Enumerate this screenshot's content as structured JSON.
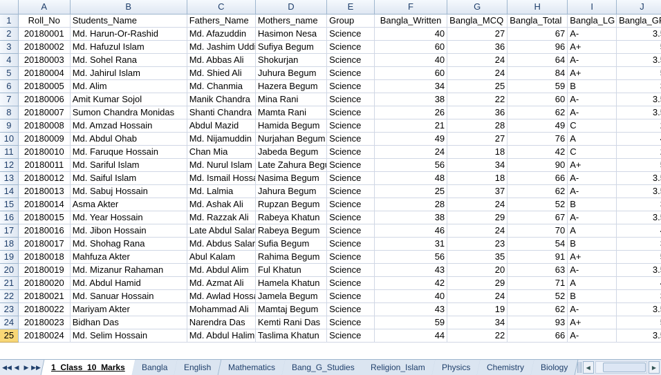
{
  "columns": [
    "A",
    "B",
    "C",
    "D",
    "E",
    "F",
    "G",
    "H",
    "I",
    "J"
  ],
  "headers": [
    "Roll_No",
    "Students_Name",
    "Fathers_Name",
    "Mothers_name",
    "Group",
    "Bangla_Written",
    "Bangla_MCQ",
    "Bangla_Total",
    "Bangla_LG",
    "Bangla_GP"
  ],
  "active_row": "25",
  "rows": [
    [
      "2",
      "20180001",
      "Md. Harun-Or-Rashid",
      "Md. Afazuddin",
      "Hasimon Nesa",
      "Science",
      "40",
      "27",
      "67",
      "A-",
      "3.5"
    ],
    [
      "3",
      "20180002",
      "Md. Hafuzul Islam",
      "Md. Jashim Uddin",
      "Sufiya Begum",
      "Science",
      "60",
      "36",
      "96",
      "A+",
      "5"
    ],
    [
      "4",
      "20180003",
      "Md. Sohel Rana",
      "Md. Abbas Ali",
      "Shokurjan",
      "Science",
      "40",
      "24",
      "64",
      "A-",
      "3.5"
    ],
    [
      "5",
      "20180004",
      "Md. Jahirul Islam",
      "Md. Shied Ali",
      "Juhura Begum",
      "Science",
      "60",
      "24",
      "84",
      "A+",
      "5"
    ],
    [
      "6",
      "20180005",
      "Md. Alim",
      "Md. Chanmia",
      "Hazera Begum",
      "Science",
      "34",
      "25",
      "59",
      "B",
      "3"
    ],
    [
      "7",
      "20180006",
      "Amit Kumar Sojol",
      "Manik Chandra",
      "Mina Rani",
      "Science",
      "38",
      "22",
      "60",
      "A-",
      "3.5"
    ],
    [
      "8",
      "20180007",
      "Sumon Chandra Monidas",
      "Shanti Chandra",
      "Mamta Rani",
      "Science",
      "26",
      "36",
      "62",
      "A-",
      "3.5"
    ],
    [
      "9",
      "20180008",
      "Md. Amzad Hossain",
      "Abdul Mazid",
      "Hamida Begum",
      "Science",
      "21",
      "28",
      "49",
      "C",
      "2"
    ],
    [
      "10",
      "20180009",
      "Md. Abdul Ohab",
      "Md. Nijamuddin",
      "Nurjahan Begum",
      "Science",
      "49",
      "27",
      "76",
      "A",
      "4"
    ],
    [
      "11",
      "20180010",
      "Md. Faruque Hossain",
      "Chan Mia",
      "Jabeda Begum",
      "Science",
      "24",
      "18",
      "42",
      "C",
      "2"
    ],
    [
      "12",
      "20180011",
      "Md. Sariful Islam",
      "Md. Nurul Islam",
      "Late Zahura Begum",
      "Science",
      "56",
      "34",
      "90",
      "A+",
      "5"
    ],
    [
      "13",
      "20180012",
      "Md. Saiful Islam",
      "Md. Ismail Hossain",
      "Nasima Begum",
      "Science",
      "48",
      "18",
      "66",
      "A-",
      "3.5"
    ],
    [
      "14",
      "20180013",
      "Md. Sabuj Hossain",
      "Md. Lalmia",
      "Jahura Begum",
      "Science",
      "25",
      "37",
      "62",
      "A-",
      "3.5"
    ],
    [
      "15",
      "20180014",
      "Asma Akter",
      "Md. Ashak Ali",
      "Rupzan Begum",
      "Science",
      "28",
      "24",
      "52",
      "B",
      "3"
    ],
    [
      "16",
      "20180015",
      "Md. Year Hossain",
      "Md. Razzak Ali",
      "Rabeya Khatun",
      "Science",
      "38",
      "29",
      "67",
      "A-",
      "3.5"
    ],
    [
      "17",
      "20180016",
      "Md. Jibon Hossain",
      "Late Abdul Salam",
      "Rabeya Begum",
      "Science",
      "46",
      "24",
      "70",
      "A",
      "4"
    ],
    [
      "18",
      "20180017",
      "Md. Shohag Rana",
      "Md. Abdus Salam",
      "Sufia Begum",
      "Science",
      "31",
      "23",
      "54",
      "B",
      "3"
    ],
    [
      "19",
      "20180018",
      "Mahfuza Akter",
      "Abul Kalam",
      "Rahima Begum",
      "Science",
      "56",
      "35",
      "91",
      "A+",
      "5"
    ],
    [
      "20",
      "20180019",
      "Md. Mizanur Rahaman",
      "Md. Abdul Alim",
      "Ful Khatun",
      "Science",
      "43",
      "20",
      "63",
      "A-",
      "3.5"
    ],
    [
      "21",
      "20180020",
      "Md. Abdul Hamid",
      "Md. Azmat Ali",
      "Hamela Khatun",
      "Science",
      "42",
      "29",
      "71",
      "A",
      "4"
    ],
    [
      "22",
      "20180021",
      "Md. Sanuar Hossain",
      "Md. Awlad Hossain",
      "Jamela Begum",
      "Science",
      "40",
      "24",
      "52",
      "B",
      "3"
    ],
    [
      "23",
      "20180022",
      "Mariyam Akter",
      "Mohammad Ali",
      "Mamtaj Begum",
      "Science",
      "43",
      "19",
      "62",
      "A-",
      "3.5"
    ],
    [
      "24",
      "20180023",
      "Bidhan Das",
      "Narendra Das",
      "Kemti Rani Das",
      "Science",
      "59",
      "34",
      "93",
      "A+",
      "5"
    ],
    [
      "25",
      "20180024",
      "Md. Selim Hossain",
      "Md. Abdul Halim",
      "Taslima Khatun",
      "Science",
      "44",
      "22",
      "66",
      "A-",
      "3.5"
    ]
  ],
  "sheet_tabs": [
    "1_Class_10_Marks",
    "Bangla",
    "English",
    "Mathematics",
    "Bang_G_Studies",
    "Religion_Islam",
    "Physics",
    "Chemistry",
    "Biology"
  ],
  "active_tab": "1_Class_10_Marks",
  "icons": {
    "nav_first": "first-sheet-icon",
    "nav_prev": "prev-sheet-icon",
    "nav_next": "next-sheet-icon",
    "nav_last": "last-sheet-icon"
  },
  "colors": {
    "grid_line": "#d0d7e5",
    "header_text": "#1f3f6b",
    "active_row_header": "#f8d776"
  }
}
